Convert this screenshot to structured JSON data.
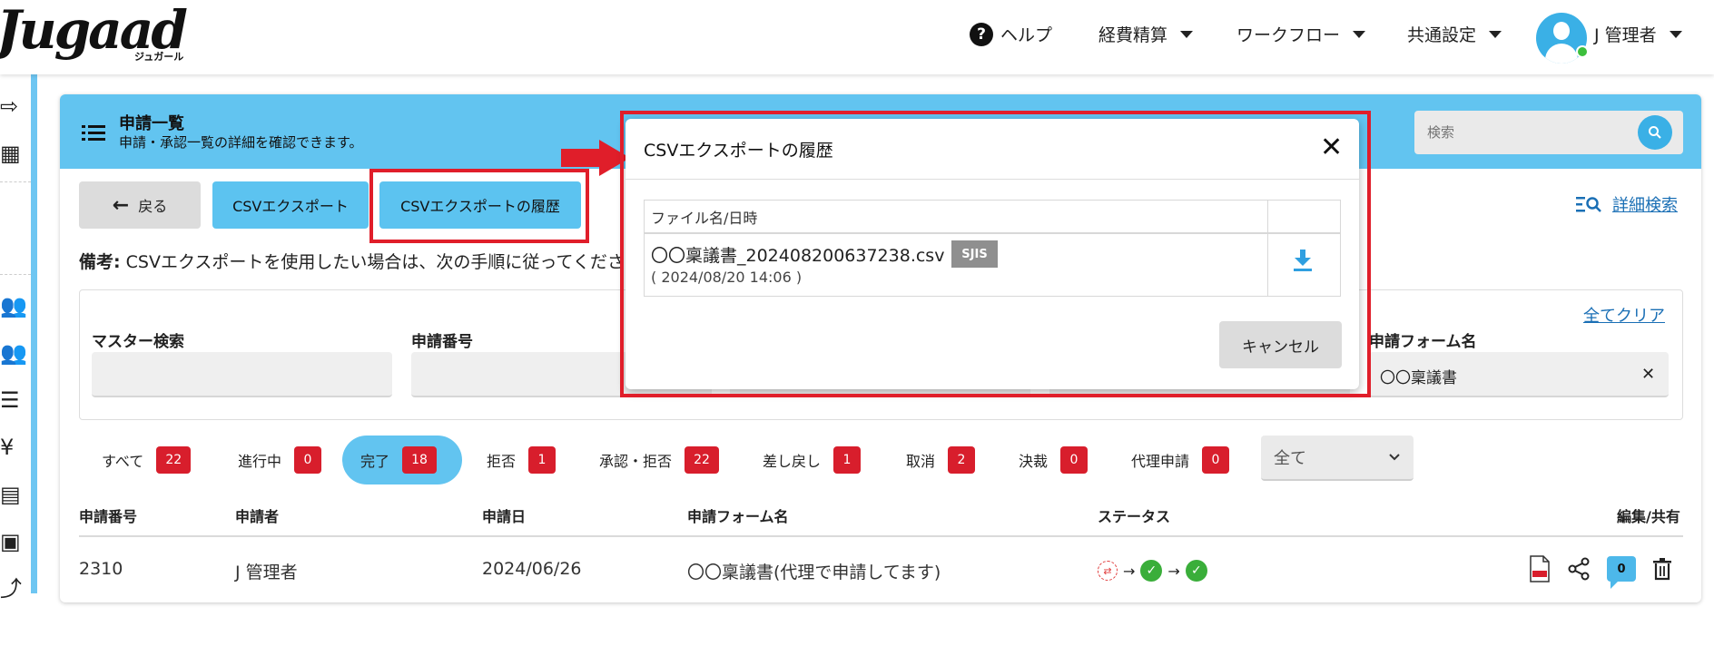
{
  "header": {
    "logo": "Jugaad",
    "logo_sub": "ジュガール",
    "nav": {
      "help": "ヘルプ",
      "help_glyph": "?",
      "expense": "経費精算",
      "workflow": "ワークフロー",
      "common_settings": "共通設定",
      "user_name": "J 管理者"
    }
  },
  "page": {
    "title": "申請一覧",
    "subtitle": "申請・承認一覧の詳細を確認できます。",
    "search_placeholder": "検索"
  },
  "toolbar": {
    "back_label": "戻る",
    "csv_export_label": "CSVエクスポート",
    "csv_history_label": "CSVエクスポートの履歴",
    "advanced_search_label": "詳細検索"
  },
  "note": {
    "prefix": "備考:",
    "text": "CSVエクスポートを使用したい場合は、次の手順に従ってくださ"
  },
  "filters": {
    "clear_all": "全てクリア",
    "master_search_label": "マスター検索",
    "application_number_label": "申請番号",
    "form_name_label": "申請フォーム名",
    "form_name_value": "〇〇稟議書"
  },
  "status_tabs": [
    {
      "label": "すべて",
      "count": "22"
    },
    {
      "label": "進行中",
      "count": "0"
    },
    {
      "label": "完了",
      "count": "18"
    },
    {
      "label": "拒否",
      "count": "1"
    },
    {
      "label": "承認・拒否",
      "count": "22"
    },
    {
      "label": "差し戻し",
      "count": "1"
    },
    {
      "label": "取消",
      "count": "2"
    },
    {
      "label": "決裁",
      "count": "0"
    },
    {
      "label": "代理申請",
      "count": "0"
    }
  ],
  "select_value": "全て",
  "table": {
    "headers": [
      "申請番号",
      "申請者",
      "申請日",
      "申請フォーム名",
      "ステータス",
      "編集/共有"
    ],
    "rows": [
      {
        "number": "2310",
        "applicant": "J 管理者",
        "date": "2024/06/26",
        "form": "〇〇稟議書(代理で申請してます)",
        "comments": "0"
      }
    ]
  },
  "modal": {
    "title": "CSVエクスポートの履歴",
    "column_header": "ファイル名/日時",
    "file_name": "〇〇稟議書_202408200637238.csv",
    "encoding": "SJIS",
    "file_date": "( 2024/08/20 14:06 )",
    "cancel_label": "キャンセル"
  },
  "colors": {
    "accent": "#62c4f0",
    "badge": "#d81e2c",
    "annotation": "#e01e2a",
    "link": "#1a6fb5"
  }
}
